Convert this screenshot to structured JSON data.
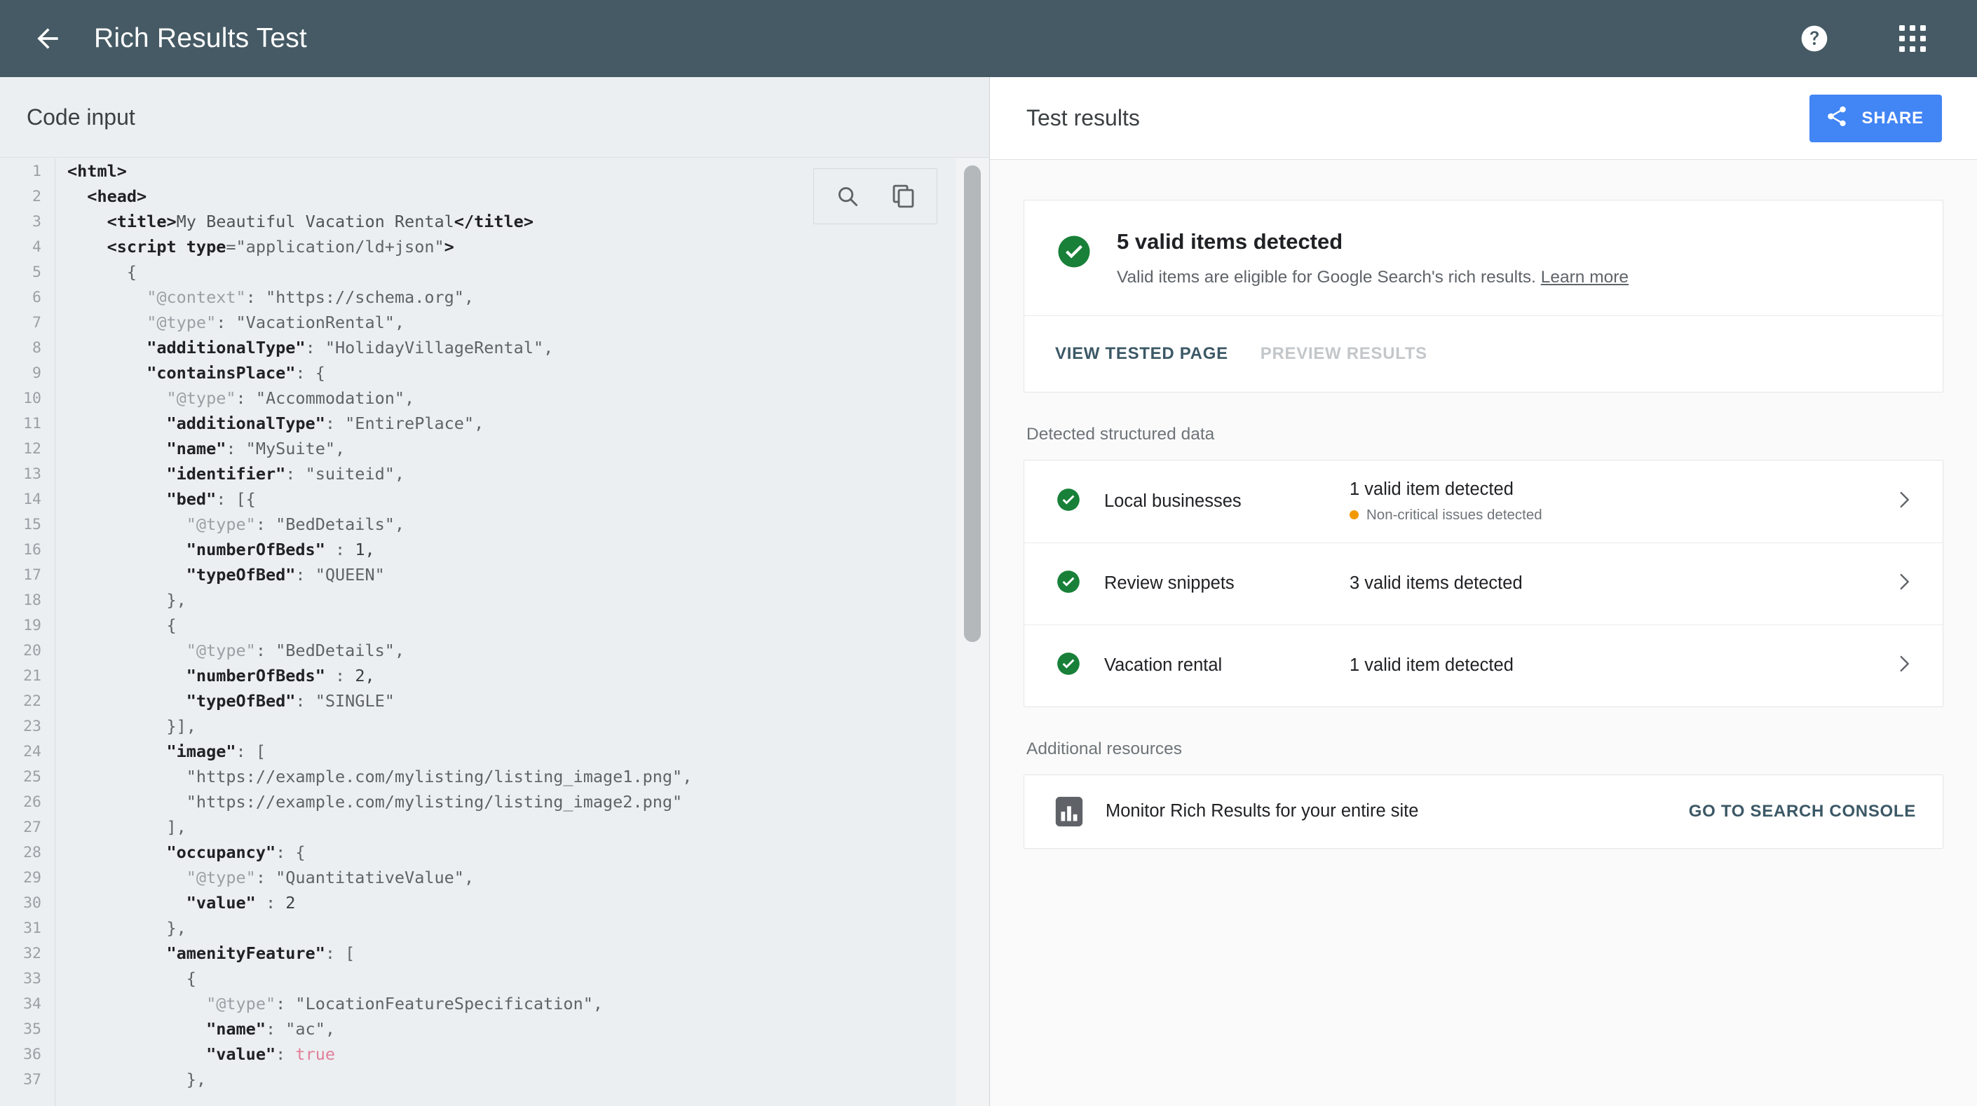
{
  "appbar": {
    "back_icon": "arrow-left-icon",
    "title": "Rich Results Test",
    "help_icon": "help-circle-icon",
    "apps_icon": "apps-grid-icon"
  },
  "code_pane": {
    "title": "Code input",
    "tools": {
      "search_icon": "search-icon",
      "copy_icon": "copy-icon"
    },
    "lines": [
      {
        "n": "1",
        "tokens": [
          {
            "t": "tag",
            "v": "<html>"
          }
        ]
      },
      {
        "n": "2",
        "tokens": [
          {
            "t": "plain",
            "v": "  "
          },
          {
            "t": "tag",
            "v": "<head>"
          }
        ]
      },
      {
        "n": "3",
        "tokens": [
          {
            "t": "plain",
            "v": "    "
          },
          {
            "t": "tag",
            "v": "<title>"
          },
          {
            "t": "plain",
            "v": "My Beautiful Vacation Rental"
          },
          {
            "t": "tag",
            "v": "</title>"
          }
        ]
      },
      {
        "n": "4",
        "tokens": [
          {
            "t": "plain",
            "v": "    "
          },
          {
            "t": "tag",
            "v": "<script type"
          },
          {
            "t": "str",
            "v": "="
          },
          {
            "t": "str",
            "v": "\"application/ld+json\""
          },
          {
            "t": "tag",
            "v": ">"
          }
        ]
      },
      {
        "n": "5",
        "tokens": [
          {
            "t": "punc",
            "v": "      {"
          }
        ]
      },
      {
        "n": "6",
        "tokens": [
          {
            "t": "plain",
            "v": "        "
          },
          {
            "t": "keydim",
            "v": "\"@context\""
          },
          {
            "t": "punc",
            "v": ": "
          },
          {
            "t": "str",
            "v": "\"https://schema.org\","
          }
        ]
      },
      {
        "n": "7",
        "tokens": [
          {
            "t": "plain",
            "v": "        "
          },
          {
            "t": "keydim",
            "v": "\"@type\""
          },
          {
            "t": "punc",
            "v": ": "
          },
          {
            "t": "str",
            "v": "\"VacationRental\","
          }
        ]
      },
      {
        "n": "8",
        "tokens": [
          {
            "t": "plain",
            "v": "        "
          },
          {
            "t": "key",
            "v": "\"additionalType\""
          },
          {
            "t": "punc",
            "v": ": "
          },
          {
            "t": "str",
            "v": "\"HolidayVillageRental\","
          }
        ]
      },
      {
        "n": "9",
        "tokens": [
          {
            "t": "plain",
            "v": "        "
          },
          {
            "t": "key",
            "v": "\"containsPlace\""
          },
          {
            "t": "punc",
            "v": ": {"
          }
        ]
      },
      {
        "n": "10",
        "tokens": [
          {
            "t": "plain",
            "v": "          "
          },
          {
            "t": "keydim",
            "v": "\"@type\""
          },
          {
            "t": "punc",
            "v": ": "
          },
          {
            "t": "str",
            "v": "\"Accommodation\","
          }
        ]
      },
      {
        "n": "11",
        "tokens": [
          {
            "t": "plain",
            "v": "          "
          },
          {
            "t": "key",
            "v": "\"additionalType\""
          },
          {
            "t": "punc",
            "v": ": "
          },
          {
            "t": "str",
            "v": "\"EntirePlace\","
          }
        ]
      },
      {
        "n": "12",
        "tokens": [
          {
            "t": "plain",
            "v": "          "
          },
          {
            "t": "key",
            "v": "\"name\""
          },
          {
            "t": "punc",
            "v": ": "
          },
          {
            "t": "str",
            "v": "\"MySuite\","
          }
        ]
      },
      {
        "n": "13",
        "tokens": [
          {
            "t": "plain",
            "v": "          "
          },
          {
            "t": "key",
            "v": "\"identifier\""
          },
          {
            "t": "punc",
            "v": ": "
          },
          {
            "t": "str",
            "v": "\"suiteid\","
          }
        ]
      },
      {
        "n": "14",
        "tokens": [
          {
            "t": "plain",
            "v": "          "
          },
          {
            "t": "key",
            "v": "\"bed\""
          },
          {
            "t": "punc",
            "v": ": [{"
          }
        ]
      },
      {
        "n": "15",
        "tokens": [
          {
            "t": "plain",
            "v": "            "
          },
          {
            "t": "keydim",
            "v": "\"@type\""
          },
          {
            "t": "punc",
            "v": ": "
          },
          {
            "t": "str",
            "v": "\"BedDetails\","
          }
        ]
      },
      {
        "n": "16",
        "tokens": [
          {
            "t": "plain",
            "v": "            "
          },
          {
            "t": "key",
            "v": "\"numberOfBeds\""
          },
          {
            "t": "punc",
            "v": " : "
          },
          {
            "t": "num",
            "v": "1,"
          }
        ]
      },
      {
        "n": "17",
        "tokens": [
          {
            "t": "plain",
            "v": "            "
          },
          {
            "t": "key",
            "v": "\"typeOfBed\""
          },
          {
            "t": "punc",
            "v": ": "
          },
          {
            "t": "str",
            "v": "\"QUEEN\""
          }
        ]
      },
      {
        "n": "18",
        "tokens": [
          {
            "t": "punc",
            "v": "          },"
          }
        ]
      },
      {
        "n": "19",
        "tokens": [
          {
            "t": "punc",
            "v": "          {"
          }
        ]
      },
      {
        "n": "20",
        "tokens": [
          {
            "t": "plain",
            "v": "            "
          },
          {
            "t": "keydim",
            "v": "\"@type\""
          },
          {
            "t": "punc",
            "v": ": "
          },
          {
            "t": "str",
            "v": "\"BedDetails\","
          }
        ]
      },
      {
        "n": "21",
        "tokens": [
          {
            "t": "plain",
            "v": "            "
          },
          {
            "t": "key",
            "v": "\"numberOfBeds\""
          },
          {
            "t": "punc",
            "v": " : "
          },
          {
            "t": "num",
            "v": "2,"
          }
        ]
      },
      {
        "n": "22",
        "tokens": [
          {
            "t": "plain",
            "v": "            "
          },
          {
            "t": "key",
            "v": "\"typeOfBed\""
          },
          {
            "t": "punc",
            "v": ": "
          },
          {
            "t": "str",
            "v": "\"SINGLE\""
          }
        ]
      },
      {
        "n": "23",
        "tokens": [
          {
            "t": "punc",
            "v": "          }],"
          }
        ]
      },
      {
        "n": "24",
        "tokens": [
          {
            "t": "plain",
            "v": "          "
          },
          {
            "t": "key",
            "v": "\"image\""
          },
          {
            "t": "punc",
            "v": ": ["
          }
        ]
      },
      {
        "n": "25",
        "tokens": [
          {
            "t": "plain",
            "v": "            "
          },
          {
            "t": "str",
            "v": "\"https://example.com/mylisting/listing_image1.png\","
          }
        ]
      },
      {
        "n": "26",
        "tokens": [
          {
            "t": "plain",
            "v": "            "
          },
          {
            "t": "str",
            "v": "\"https://example.com/mylisting/listing_image2.png\""
          }
        ]
      },
      {
        "n": "27",
        "tokens": [
          {
            "t": "punc",
            "v": "          ],"
          }
        ]
      },
      {
        "n": "28",
        "tokens": [
          {
            "t": "plain",
            "v": "          "
          },
          {
            "t": "key",
            "v": "\"occupancy\""
          },
          {
            "t": "punc",
            "v": ": {"
          }
        ]
      },
      {
        "n": "29",
        "tokens": [
          {
            "t": "plain",
            "v": "            "
          },
          {
            "t": "keydim",
            "v": "\"@type\""
          },
          {
            "t": "punc",
            "v": ": "
          },
          {
            "t": "str",
            "v": "\"QuantitativeValue\","
          }
        ]
      },
      {
        "n": "30",
        "tokens": [
          {
            "t": "plain",
            "v": "            "
          },
          {
            "t": "key",
            "v": "\"value\""
          },
          {
            "t": "punc",
            "v": " : "
          },
          {
            "t": "num",
            "v": "2"
          }
        ]
      },
      {
        "n": "31",
        "tokens": [
          {
            "t": "punc",
            "v": "          },"
          }
        ]
      },
      {
        "n": "32",
        "tokens": [
          {
            "t": "plain",
            "v": "          "
          },
          {
            "t": "key",
            "v": "\"amenityFeature\""
          },
          {
            "t": "punc",
            "v": ": ["
          }
        ]
      },
      {
        "n": "33",
        "tokens": [
          {
            "t": "punc",
            "v": "            {"
          }
        ]
      },
      {
        "n": "34",
        "tokens": [
          {
            "t": "plain",
            "v": "              "
          },
          {
            "t": "keydim",
            "v": "\"@type\""
          },
          {
            "t": "punc",
            "v": ": "
          },
          {
            "t": "str",
            "v": "\"LocationFeatureSpecification\","
          }
        ]
      },
      {
        "n": "35",
        "tokens": [
          {
            "t": "plain",
            "v": "              "
          },
          {
            "t": "key",
            "v": "\"name\""
          },
          {
            "t": "punc",
            "v": ": "
          },
          {
            "t": "str",
            "v": "\"ac\","
          }
        ]
      },
      {
        "n": "36",
        "tokens": [
          {
            "t": "plain",
            "v": "              "
          },
          {
            "t": "key",
            "v": "\"value\""
          },
          {
            "t": "punc",
            "v": ": "
          },
          {
            "t": "bool",
            "v": "true"
          }
        ]
      },
      {
        "n": "37",
        "tokens": [
          {
            "t": "punc",
            "v": "            },"
          }
        ]
      }
    ]
  },
  "results": {
    "title": "Test results",
    "share_button": {
      "label": "SHARE",
      "icon": "share-icon",
      "color": "#4285F4"
    },
    "summary": {
      "status_icon": "check-circle-icon",
      "status_color": "#188038",
      "heading": "5 valid items detected",
      "subtext": "Valid items are eligible for Google Search's rich results. ",
      "learn_more": "Learn more",
      "actions": [
        {
          "label": "VIEW TESTED PAGE",
          "enabled": true
        },
        {
          "label": "PREVIEW RESULTS",
          "enabled": false
        }
      ]
    },
    "detected_label": "Detected structured data",
    "detected_items": [
      {
        "icon": "check-circle-icon",
        "name": "Local businesses",
        "status": "1 valid item detected",
        "sub_status": "Non-critical issues detected",
        "sub_status_color": "#F29900",
        "chevron": "chevron-right-icon"
      },
      {
        "icon": "check-circle-icon",
        "name": "Review snippets",
        "status": "3 valid items detected",
        "sub_status": "",
        "chevron": "chevron-right-icon"
      },
      {
        "icon": "check-circle-icon",
        "name": "Vacation rental",
        "status": "1 valid item detected",
        "sub_status": "",
        "chevron": "chevron-right-icon"
      }
    ],
    "additional_label": "Additional resources",
    "resource": {
      "icon": "bar-chart-icon",
      "label": "Monitor Rich Results for your entire site",
      "link_label": "GO TO SEARCH CONSOLE"
    }
  }
}
